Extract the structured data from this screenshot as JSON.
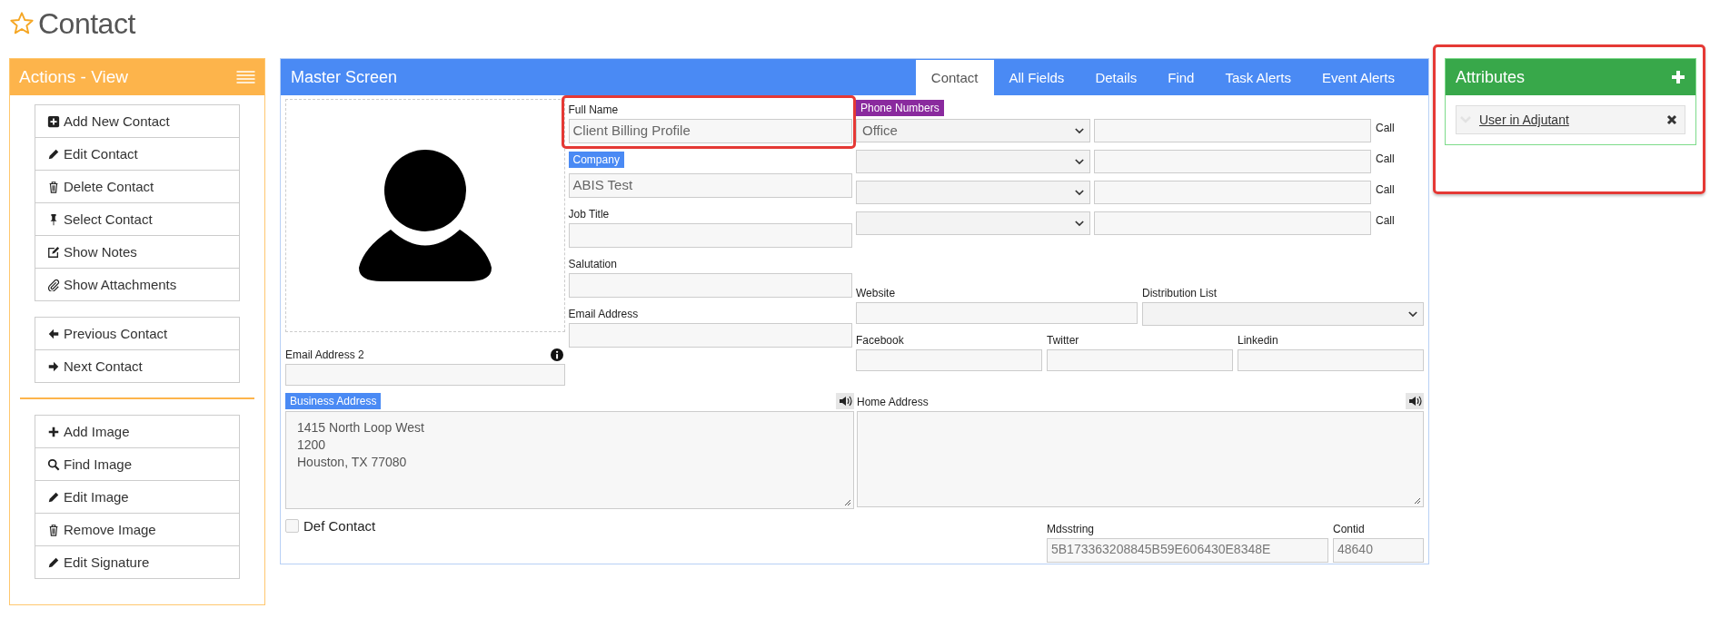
{
  "page_title": "Contact",
  "actions_panel": {
    "title": "Actions - View",
    "contact_actions": [
      {
        "items": [
          {
            "label": "Add New Contact",
            "kind": "addbox"
          },
          {
            "label": "Edit Contact",
            "kind": "pencil"
          },
          {
            "label": "Delete Contact",
            "kind": "trash"
          },
          {
            "label": "Select Contact",
            "kind": "pin"
          },
          {
            "label": "Show Notes",
            "kind": "note"
          },
          {
            "label": "Show Attachments",
            "kind": "clip"
          }
        ]
      },
      {
        "items": [
          {
            "label": "Previous Contact",
            "kind": "left"
          },
          {
            "label": "Next Contact",
            "kind": "right"
          }
        ]
      }
    ],
    "image_actions": {
      "items": [
        {
          "label": "Add Image",
          "kind": "plus"
        },
        {
          "label": "Find Image",
          "kind": "search"
        },
        {
          "label": "Edit Image",
          "kind": "pencil"
        },
        {
          "label": "Remove Image",
          "kind": "trash"
        },
        {
          "label": "Edit Signature",
          "kind": "pencil"
        }
      ]
    }
  },
  "master": {
    "title": "Master Screen",
    "tabs": [
      {
        "label": "Contact",
        "selected": true
      },
      {
        "label": "All Fields",
        "selected": false
      },
      {
        "label": "Details",
        "selected": false
      },
      {
        "label": "Find",
        "selected": false
      },
      {
        "label": "Task Alerts",
        "selected": false
      },
      {
        "label": "Event Alerts",
        "selected": false
      }
    ],
    "email_address_2": {
      "label": "Email Address 2"
    },
    "fields": [
      {
        "label": "Full Name",
        "value": "Client Billing Profile",
        "kind": "plain",
        "highlighted": true
      },
      {
        "label": "Company",
        "value": "ABIS Test",
        "kind": "tag",
        "highlighted": false
      },
      {
        "label": "Job Title",
        "kind": "plain",
        "highlighted": false
      },
      {
        "label": "Salutation",
        "kind": "plain",
        "highlighted": false
      },
      {
        "label": "Email Address",
        "kind": "plain",
        "highlighted": false
      }
    ],
    "phone_numbers": {
      "label": "Phone Numbers",
      "rows": [
        {
          "type": "Office",
          "action": "Call"
        },
        {
          "action": "Call"
        },
        {
          "action": "Call"
        },
        {
          "action": "Call"
        }
      ]
    },
    "website": {
      "label": "Website"
    },
    "distribution_list": {
      "label": "Distribution List"
    },
    "social": [
      {
        "label": "Facebook"
      },
      {
        "label": "Twitter"
      },
      {
        "label": "Linkedin"
      }
    ],
    "business_address": {
      "label": "Business Address",
      "lines": [
        "1415 North Loop West",
        "1200",
        "Houston, TX 77080"
      ]
    },
    "def_contact": {
      "label": "Def Contact",
      "checked": false
    },
    "home_address": {
      "label": "Home Address"
    },
    "mdsstring": {
      "label": "Mdsstring",
      "value": "5B173363208845B59E606430E8348E"
    },
    "contid": {
      "label": "Contid",
      "value": "48640"
    }
  },
  "attributes": {
    "title": "Attributes",
    "highlighted": true,
    "items": [
      {
        "label": "User in Adjutant"
      }
    ]
  }
}
